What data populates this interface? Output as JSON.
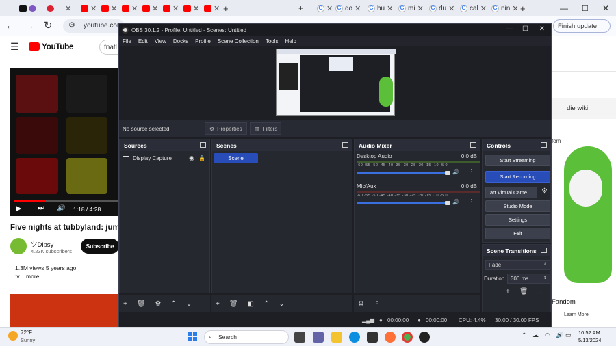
{
  "browser": {
    "tabs_left": [
      "",
      "",
      "",
      "",
      "",
      "",
      "",
      "",
      ""
    ],
    "tabs_right": [
      "do",
      "bu",
      "mi",
      "du",
      "cal",
      "nin"
    ],
    "url": "youtube.com",
    "finish_update": "Finish update"
  },
  "youtube": {
    "logo": "YouTube",
    "search_partial": "fnatl",
    "player_time": "1:18 / 4:28",
    "video_title": "Five nights at tubbyland: jump",
    "channel": "ツDipsy",
    "subscribers": "4.23K subscribers",
    "subscribe": "Subscribe",
    "views": "1.3M views  5 years ago",
    "more": ":v ...more"
  },
  "right_page": {
    "search_text": "die wiki",
    "fom": "fom",
    "fandom": "Fandom",
    "learn_more": "Learn More"
  },
  "obs": {
    "title": "OBS 30.1.2 - Profile: Untitled - Scenes: Untitled",
    "menu": [
      "File",
      "Edit",
      "View",
      "Docks",
      "Profile",
      "Scene Collection",
      "Tools",
      "Help"
    ],
    "no_source": "No source selected",
    "properties": "Properties",
    "filters": "Filters",
    "docks": {
      "sources": "Sources",
      "scenes": "Scenes",
      "audio_mixer": "Audio Mixer",
      "controls": "Controls",
      "transitions": "Scene Transitions"
    },
    "source_item": "Display Capture",
    "scene_item": "Scene",
    "audio": [
      {
        "name": "Desktop Audio",
        "db": "0.0 dB"
      },
      {
        "name": "Mic/Aux",
        "db": "0.0 dB"
      }
    ],
    "meter_ticks": "-60 -55 -50 -45 -40 -35 -30 -25 -20 -15 -10  -5   0",
    "controls": [
      "Start Streaming",
      "Start Recording",
      "art Virtual Came",
      "Studio Mode",
      "Settings",
      "Exit"
    ],
    "transition": "Fade",
    "duration_label": "Duration",
    "duration": "300 ms",
    "status": {
      "stream_time": "00:00:00",
      "rec_time": "00:00:00",
      "cpu": "CPU: 4.4%",
      "fps": "30.00 / 30.00 FPS"
    }
  },
  "taskbar": {
    "weather_temp": "72°F",
    "weather_desc": "Sunny",
    "search": "Search",
    "time": "10:52 AM",
    "date": "5/13/2024"
  },
  "colors": {
    "obs_bg": "#1e1f25",
    "obs_blue": "#284cb8",
    "yt_red": "#ff0000"
  }
}
